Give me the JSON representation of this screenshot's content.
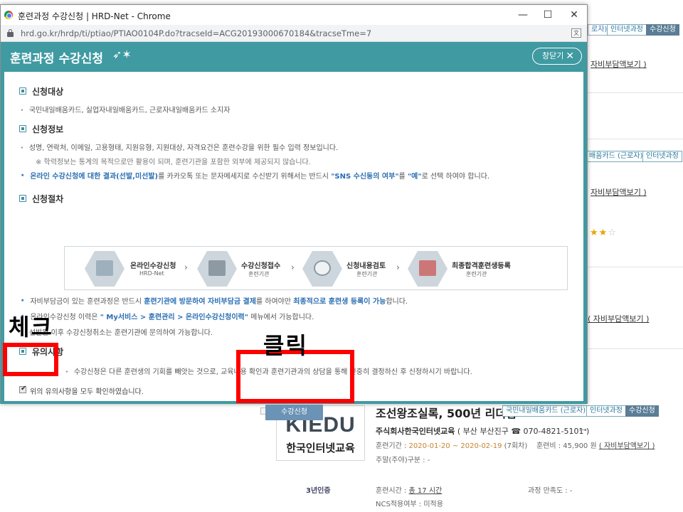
{
  "window": {
    "title": "훈련과정 수강신청 | HRD-Net - Chrome",
    "url": "hrd.go.kr/hrdp/ti/ptiao/PTIAO0104P.do?tracseId=ACG20193000670184&tracseTme=7",
    "minimize": "—",
    "maximize": "☐",
    "close": "✕"
  },
  "popup": {
    "title": "훈련과정 수강신청",
    "close_label": "창닫기",
    "close_x": "✕",
    "sections": {
      "target": {
        "heading": "신청대상",
        "items": [
          "국민내일배움카드, 실업자내일배움카드, 근로자내일배움카드 소지자"
        ]
      },
      "info": {
        "heading": "신청정보",
        "item1": "성명, 연락처, 이메일, 고용형태, 지원유형, 지원대상, 자격요건은 훈련수강을 위한 필수 입력 정보입니다.",
        "note": "※ 학력정보는 통계의 목적으로만 활용이 되며, 훈련기관을 포함한 외부에 제공되지 않습니다.",
        "item2_hl1": "온라인 수강신청에 대한 결과(선발,미선발)",
        "item2_t1": "를 카카오톡 또는 문자메세지로 수신받기 위해서는 반드시 ",
        "item2_hl2": "\"SNS 수신동의 여부\"",
        "item2_t2": "를 ",
        "item2_hl3": "\"예\"",
        "item2_t3": "로 선택 하여야 합니다."
      },
      "procedure": {
        "heading": "신청절차",
        "steps": [
          {
            "title": "온라인수강신청",
            "sub": "HRD-Net"
          },
          {
            "title": "수강신청접수",
            "sub": "훈련기관"
          },
          {
            "title": "신청내용검토",
            "sub": "훈련기관"
          },
          {
            "title": "최종합격훈련생등록",
            "sub": "훈련기관"
          }
        ],
        "arrow": "›",
        "item1_t1": "자비부담금이 있는 훈련과정은 반드시 ",
        "item1_hl1": "훈련기관에 방문하여 자비부담금 결제",
        "item1_t2": "를 하여야만 ",
        "item1_hl2": "최종적으로 훈련생 등록이 가능",
        "item1_t3": "합니다.",
        "item2_t1": "온라인수강신청 이력은 ",
        "item2_hl": "\" My서비스 > 훈련관리 > 온라인수강신청이력\"",
        "item2_t2": " 메뉴에서 가능합니다.",
        "item3": "선발된 이후 수강신청취소는 훈련기관에 문의하여 가능합니다."
      },
      "caution": {
        "heading": "유의사항",
        "item1_visible": "수강신청은 다른 훈련생의 기회를 빼앗는 것으로, 교육내용 확인과 훈련기관과의 상담을 통해 신중히 결정하신 후 신청하시기 바랍니다.",
        "agree_label": "위의 유의사항을 모두 확인하였습니다.",
        "apply_button": "수강신청"
      }
    }
  },
  "annotations": {
    "check_label": "체크",
    "click_label": "클릭",
    "color": "#ff0000"
  },
  "background": {
    "tags_row1": [
      "로자)",
      "인터넷과정",
      "수강신청"
    ],
    "tags_row2": [
      "배움카드 (근로자)",
      "인터넷과정"
    ],
    "links": [
      "자비부담액보기 )",
      "자비부담액보기 )",
      "( 자비부담액보기 )"
    ],
    "stars": "★★",
    "star_off": "☆",
    "course": {
      "logo_main": "KIEDU",
      "logo_sub": "한국인터넷교육",
      "cert": "3년인증",
      "title": "조선왕조실록, 500년 리더십",
      "tags": [
        "국민내일배움카드 (근로자)",
        "인터넷과정",
        "수강신청"
      ],
      "company": "주식회사한국인터넷교육",
      "company_rest": " ( 부산 부산진구 ☎ 070-4821-5101 )",
      "period_label": "훈련기간 : ",
      "period_value": "2020-01-20 ~ 2020-02-19",
      "period_count": " (7회차)",
      "fee_label": "훈련비 : ",
      "fee_value": "45,900 원",
      "fee_link": "( 자비부담액보기 )",
      "day_type": "주말(주야)구분 : -",
      "hours_label": "훈련시간 : ",
      "hours_value": "총 17 시간",
      "satisfaction": "과정 만족도 : -",
      "ncs": "NCS적용여부 : 미적용"
    }
  }
}
